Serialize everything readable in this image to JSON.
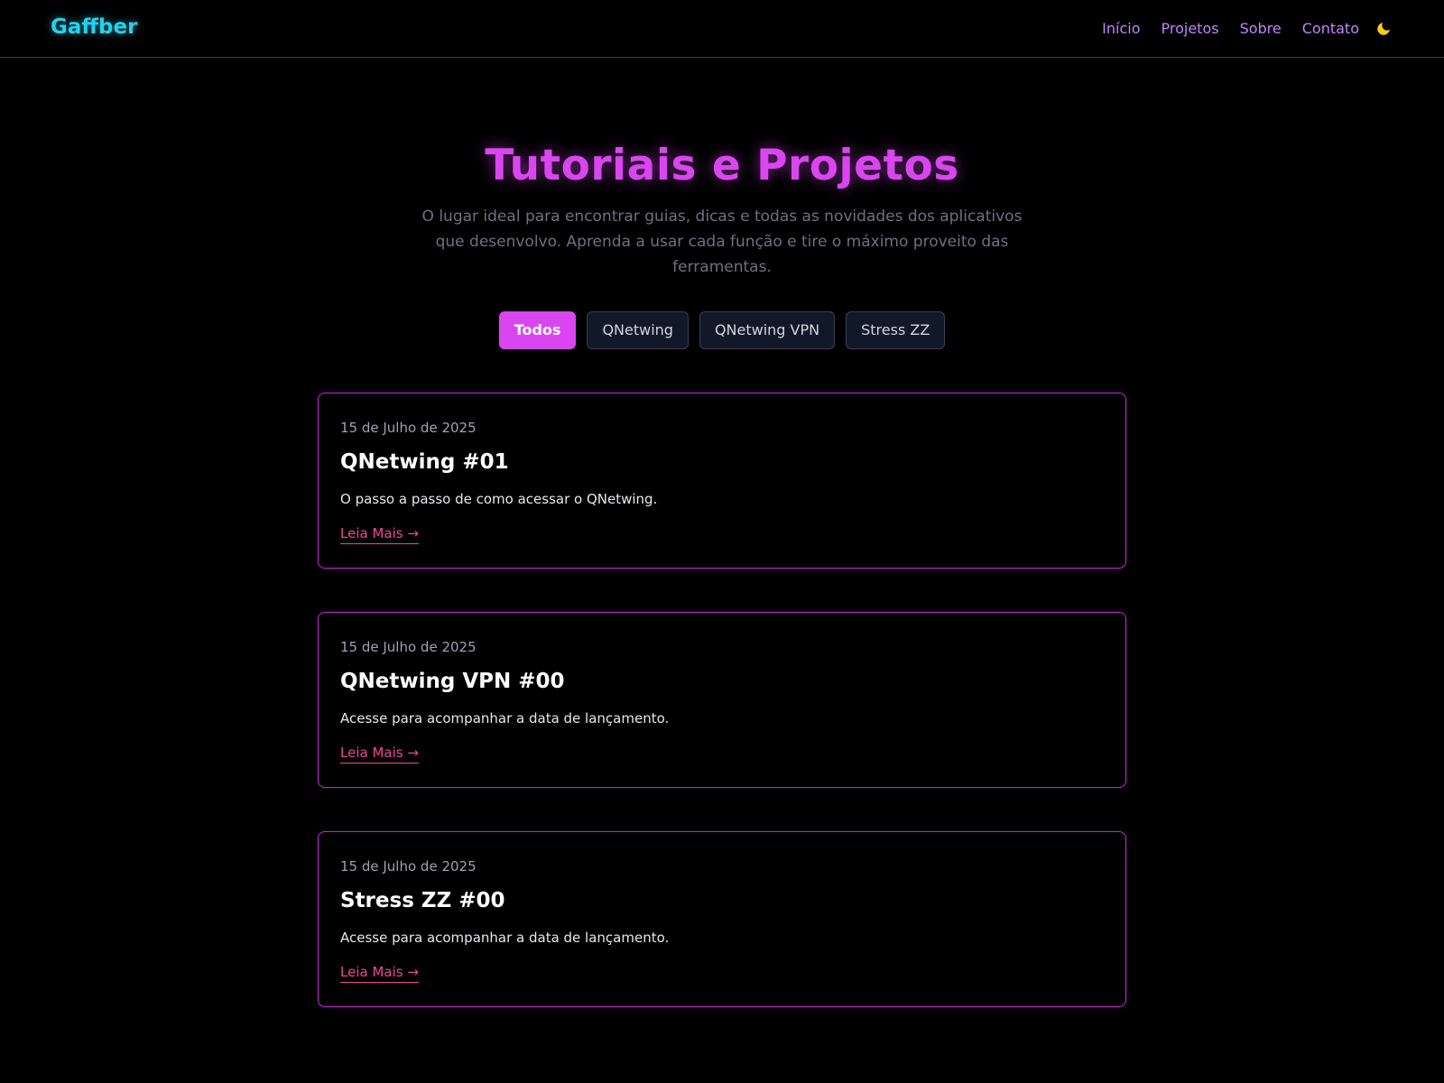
{
  "header": {
    "logo": "Gaffber",
    "nav": [
      "Início",
      "Projetos",
      "Sobre",
      "Contato"
    ],
    "theme_icon": "moon-icon",
    "theme_icon_color": "#facc15"
  },
  "hero": {
    "title": "Tutoriais e Projetos",
    "subtitle": "O lugar ideal para encontrar guias, dicas e todas as novidades dos aplicativos que desenvolvo. Aprenda a usar cada função e tire o máximo proveito das ferramentas."
  },
  "filters": {
    "items": [
      "Todos",
      "QNetwing",
      "QNetwing VPN",
      "Stress ZZ"
    ],
    "active": "Todos"
  },
  "posts": [
    {
      "date": "15 de Julho de 2025",
      "title": "QNetwing #01",
      "description": "O passo a passo de como acessar o QNetwing.",
      "link": "Leia Mais →"
    },
    {
      "date": "15 de Julho de 2025",
      "title": "QNetwing VPN #00",
      "description": "Acesse para acompanhar a data de lançamento.",
      "link": "Leia Mais →"
    },
    {
      "date": "15 de Julho de 2025",
      "title": "Stress ZZ #00",
      "description": "Acesse para acompanhar a data de lançamento.",
      "link": "Leia Mais →"
    }
  ],
  "colors": {
    "background": "#000000",
    "logo": "#22d3ee",
    "nav": "#c084fc",
    "accent": "#d946ef",
    "card_border": "#c026d3",
    "link": "#ec4899",
    "muted_text": "#6b7280"
  }
}
